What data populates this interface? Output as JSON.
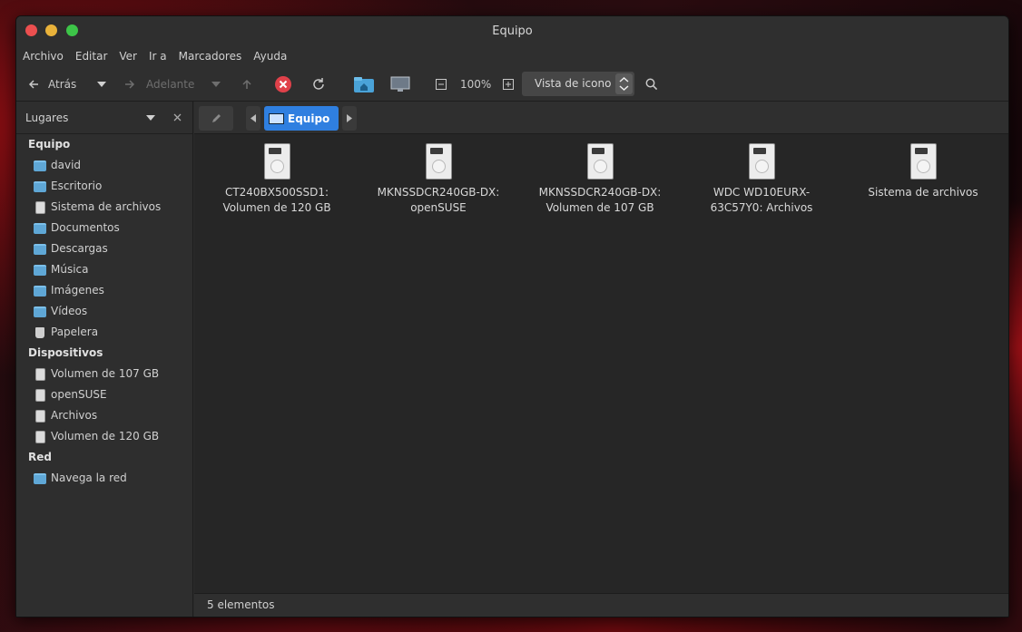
{
  "window": {
    "title": "Equipo"
  },
  "menu": [
    "Archivo",
    "Editar",
    "Ver",
    "Ir a",
    "Marcadores",
    "Ayuda"
  ],
  "toolbar": {
    "back_label": "Atrás",
    "forward_label": "Adelante",
    "zoom": "100%",
    "view_mode": "Vista de icono"
  },
  "sidebar": {
    "header": "Lugares",
    "sections": [
      {
        "title": "Equipo",
        "items": [
          {
            "label": "david",
            "icon": "home-folder"
          },
          {
            "label": "Escritorio",
            "icon": "desktop-folder"
          },
          {
            "label": "Sistema de archivos",
            "icon": "drive"
          },
          {
            "label": "Documentos",
            "icon": "documents-folder"
          },
          {
            "label": "Descargas",
            "icon": "downloads-folder"
          },
          {
            "label": "Música",
            "icon": "music-folder"
          },
          {
            "label": "Imágenes",
            "icon": "pictures-folder"
          },
          {
            "label": "Vídeos",
            "icon": "videos-folder"
          },
          {
            "label": "Papelera",
            "icon": "trash"
          }
        ]
      },
      {
        "title": "Dispositivos",
        "items": [
          {
            "label": "Volumen de 107 GB",
            "icon": "drive"
          },
          {
            "label": "openSUSE",
            "icon": "drive"
          },
          {
            "label": "Archivos",
            "icon": "drive"
          },
          {
            "label": "Volumen de 120 GB",
            "icon": "drive"
          }
        ]
      },
      {
        "title": "Red",
        "items": [
          {
            "label": "Navega la red",
            "icon": "network-folder"
          }
        ]
      }
    ]
  },
  "pathbar": {
    "current": "Equipo"
  },
  "files": [
    {
      "line1": "CT240BX500SSD1:",
      "line2": "Volumen de 120 GB"
    },
    {
      "line1": "MKNSSDCR240GB-DX:",
      "line2": "openSUSE"
    },
    {
      "line1": "MKNSSDCR240GB-DX:",
      "line2": "Volumen de 107 GB"
    },
    {
      "line1": "WDC WD10EURX-",
      "line2": "63C57Y0: Archivos"
    },
    {
      "line1": "Sistema de archivos",
      "line2": ""
    }
  ],
  "status": {
    "text": "5 elementos"
  },
  "colors": {
    "accent": "#2f7fe0",
    "stop": "#e0414a"
  }
}
